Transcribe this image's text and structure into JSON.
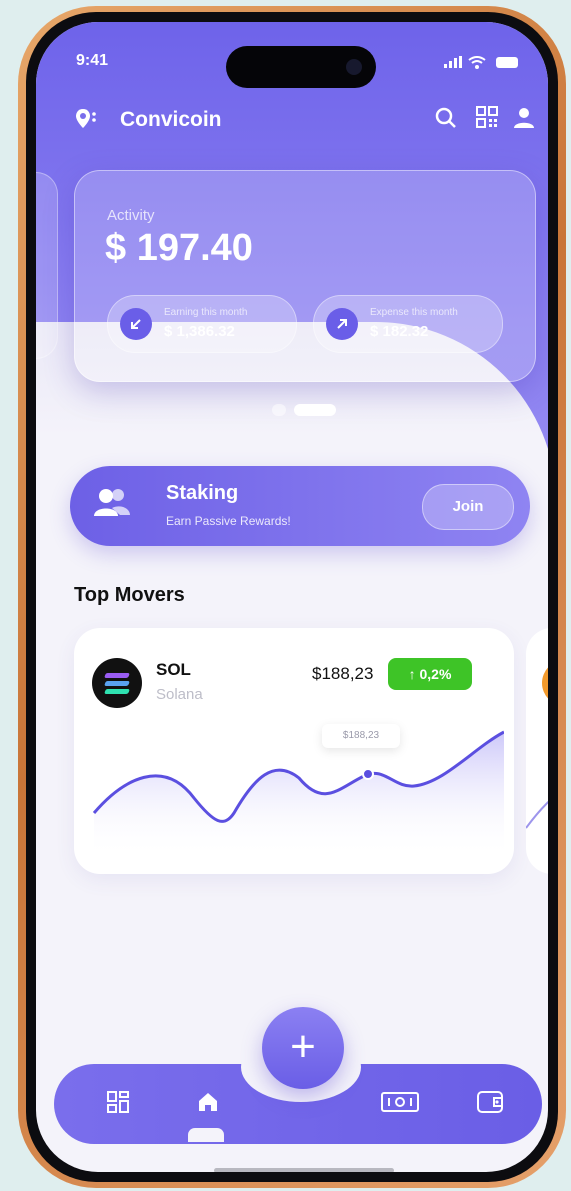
{
  "status_bar": {
    "time": "9:41",
    "signal": "❘❘❘",
    "wifi": "◠"
  },
  "header": {
    "app_name": "Convicoin",
    "logo_icon": "location-pin-icon",
    "actions": [
      "search-icon",
      "qr-code-icon",
      "user-icon"
    ]
  },
  "activity": {
    "label": "Activity",
    "value": "$ 197.40",
    "earning": {
      "label": "Earning this month",
      "value": "$ 1,386.32",
      "icon": "arrow-down-left-icon"
    },
    "expense": {
      "label": "Expense this month",
      "value": "$ 182.32",
      "icon": "arrow-up-right-icon"
    }
  },
  "carousel": {
    "pages": 2,
    "active_index": 1
  },
  "staking": {
    "title": "Staking",
    "subtitle": "Earn Passive Rewards!",
    "action_label": "Join"
  },
  "top_movers": {
    "title": "Top Movers",
    "items": [
      {
        "symbol": "SOL",
        "name": "Solana",
        "price": "$188,23",
        "change": "↑ 0,2%",
        "tooltip": "$188,23",
        "change_color": "#3ec427"
      }
    ],
    "next_item_icon": "bitcoin-icon",
    "next_item_glyph": "₿"
  },
  "bottom_nav": {
    "add_label": "+",
    "items": [
      "dashboard-icon",
      "home-icon",
      "banknote-icon",
      "wallet-icon"
    ],
    "active_index": 1
  },
  "colors": {
    "accent": "#6e63ea",
    "positive": "#3ec427",
    "bitcoin": "#f39a2b"
  }
}
